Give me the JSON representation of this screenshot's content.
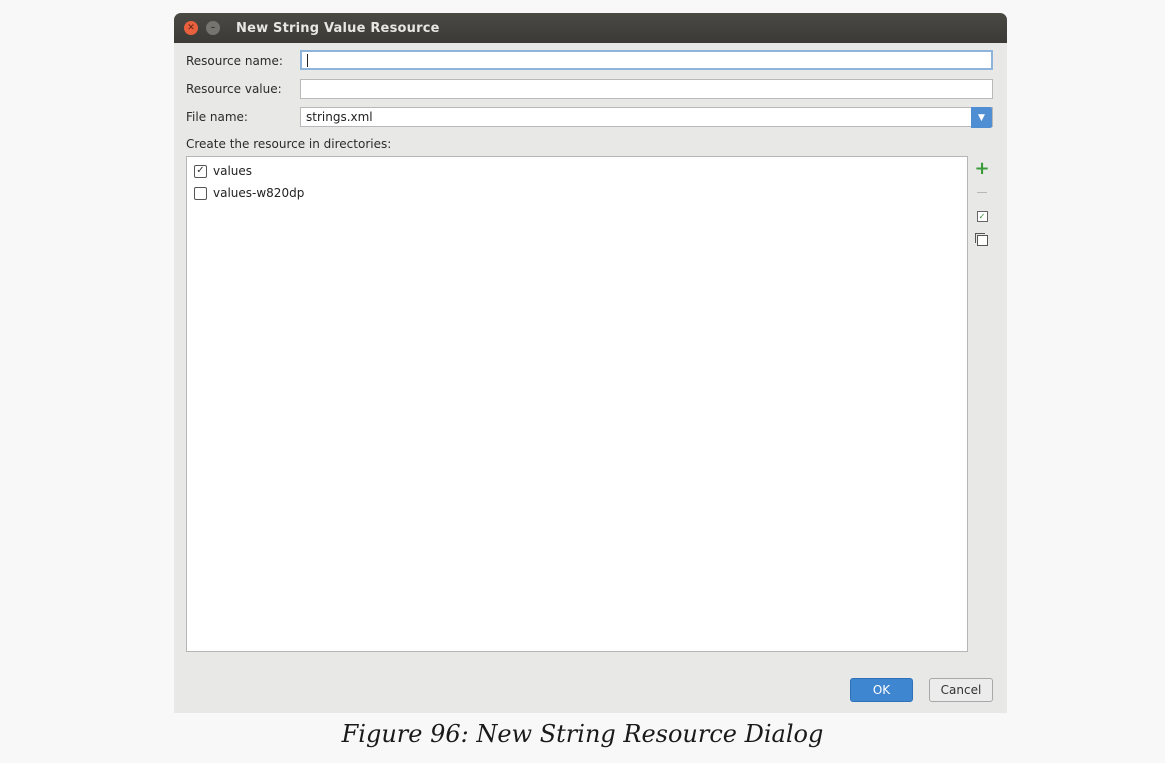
{
  "dialog": {
    "title": "New String Value Resource",
    "close_icon": "close-icon",
    "minimize_icon": "minimize-icon"
  },
  "form": {
    "resource_name_label": "Resource name:",
    "resource_name_value": "",
    "resource_value_label": "Resource value:",
    "resource_value_value": "",
    "file_name_label": "File name:",
    "file_name_value": "strings.xml",
    "directories_label": "Create the resource in directories:"
  },
  "directories": [
    {
      "label": "values",
      "checked": true
    },
    {
      "label": "values-w820dp",
      "checked": false
    }
  ],
  "toolbar_icons": [
    "plus-icon",
    "minus-icon",
    "check-all-icon",
    "uncheck-all-icon"
  ],
  "buttons": {
    "ok": "OK",
    "cancel": "Cancel"
  },
  "colors": {
    "accent": "#3f86d0",
    "add_icon": "#3b9b3b"
  },
  "caption": "Figure 96: New String Resource Dialog"
}
